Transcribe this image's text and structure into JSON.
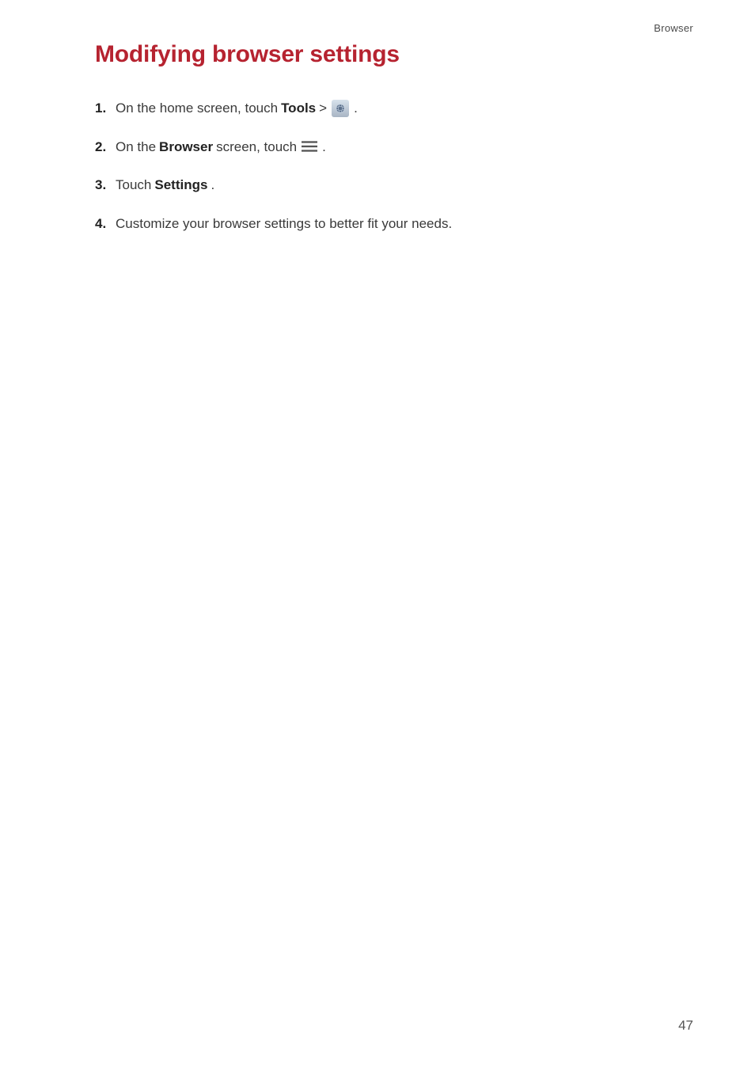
{
  "header": {
    "breadcrumb": "Browser"
  },
  "heading": "Modifying browser settings",
  "steps": [
    {
      "num": "1.",
      "parts": [
        {
          "type": "text",
          "value": "On the home screen, touch "
        },
        {
          "type": "bold",
          "value": "Tools"
        },
        {
          "type": "text",
          "value": " > "
        },
        {
          "type": "icon",
          "value": "globe"
        },
        {
          "type": "text",
          "value": "."
        }
      ]
    },
    {
      "num": "2.",
      "parts": [
        {
          "type": "text",
          "value": "On the "
        },
        {
          "type": "bold",
          "value": "Browser"
        },
        {
          "type": "text",
          "value": " screen, touch "
        },
        {
          "type": "icon",
          "value": "menu"
        },
        {
          "type": "text",
          "value": "."
        }
      ]
    },
    {
      "num": "3.",
      "parts": [
        {
          "type": "text",
          "value": "Touch "
        },
        {
          "type": "bold",
          "value": "Settings"
        },
        {
          "type": "text",
          "value": "."
        }
      ]
    },
    {
      "num": "4.",
      "parts": [
        {
          "type": "text",
          "value": "Customize your browser settings to better fit your needs."
        }
      ]
    }
  ],
  "pageNumber": "47"
}
